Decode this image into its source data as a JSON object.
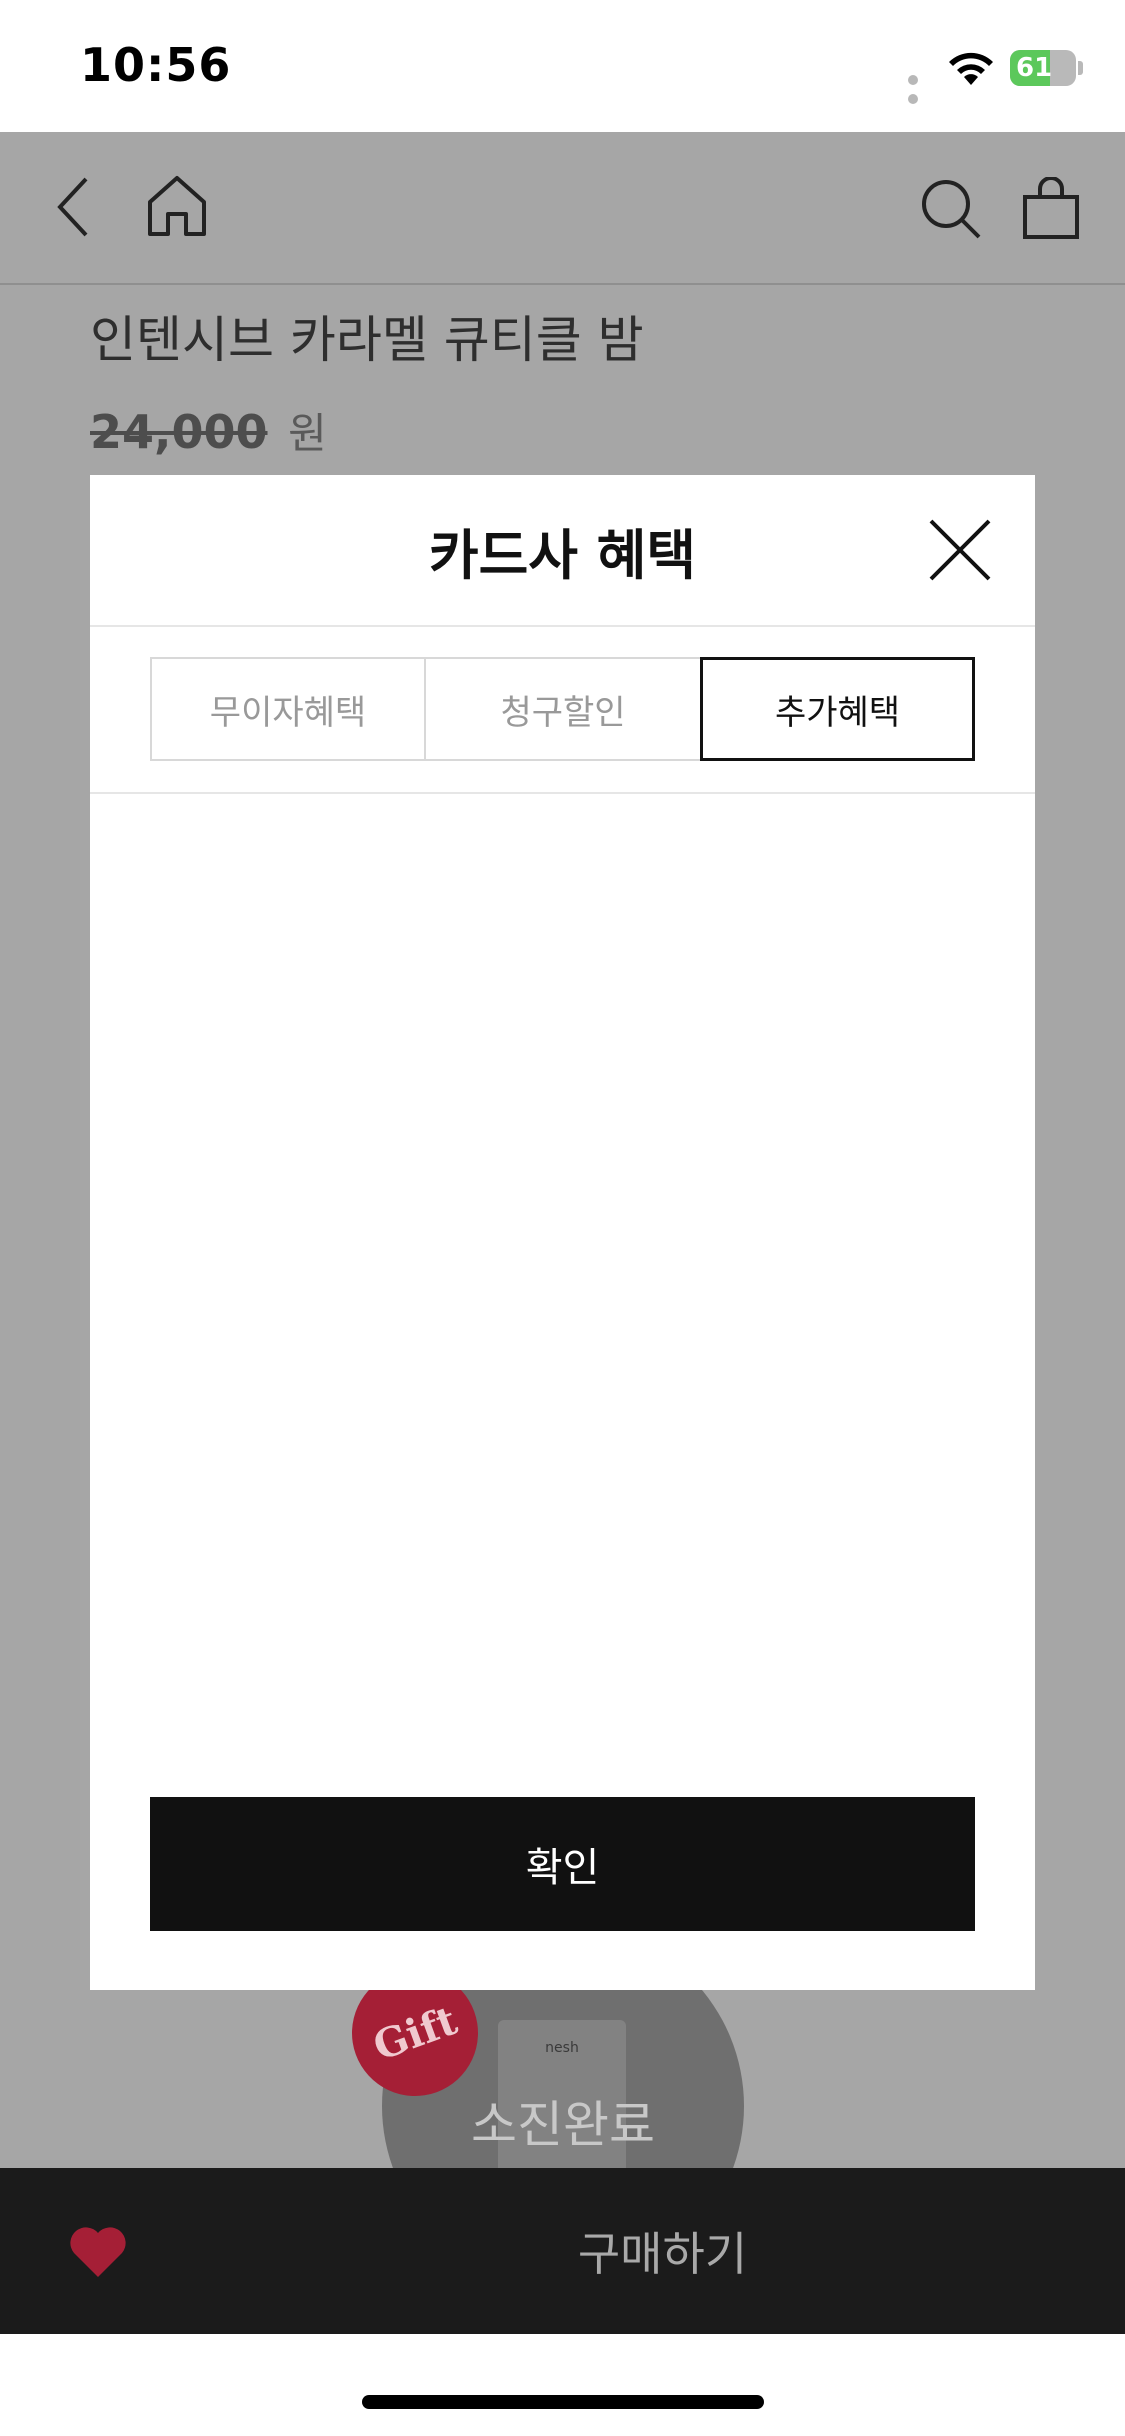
{
  "status_bar": {
    "time": "10:56",
    "battery": "61",
    "battery_level": 0.61
  },
  "nav": {
    "icons": [
      "back-icon",
      "home-icon",
      "search-icon",
      "shopping-bag-icon"
    ]
  },
  "product": {
    "title": "인텐시브 카라멜 큐티클 밤",
    "price": "24,000",
    "currency": "원"
  },
  "modal": {
    "title": "카드사 혜택",
    "tabs": [
      {
        "label": "무이자혜택",
        "active": false
      },
      {
        "label": "청구할인",
        "active": false
      },
      {
        "label": "추가혜택",
        "active": true
      }
    ],
    "confirm_label": "확인"
  },
  "gift": {
    "badge": "Gift",
    "status": "소진완료",
    "product_brand": "nesh"
  },
  "bottom_bar": {
    "buy_label": "구매하기"
  },
  "colors": {
    "accent": "#a51f36",
    "dim": "#a6a6a6",
    "button": "#111111"
  }
}
